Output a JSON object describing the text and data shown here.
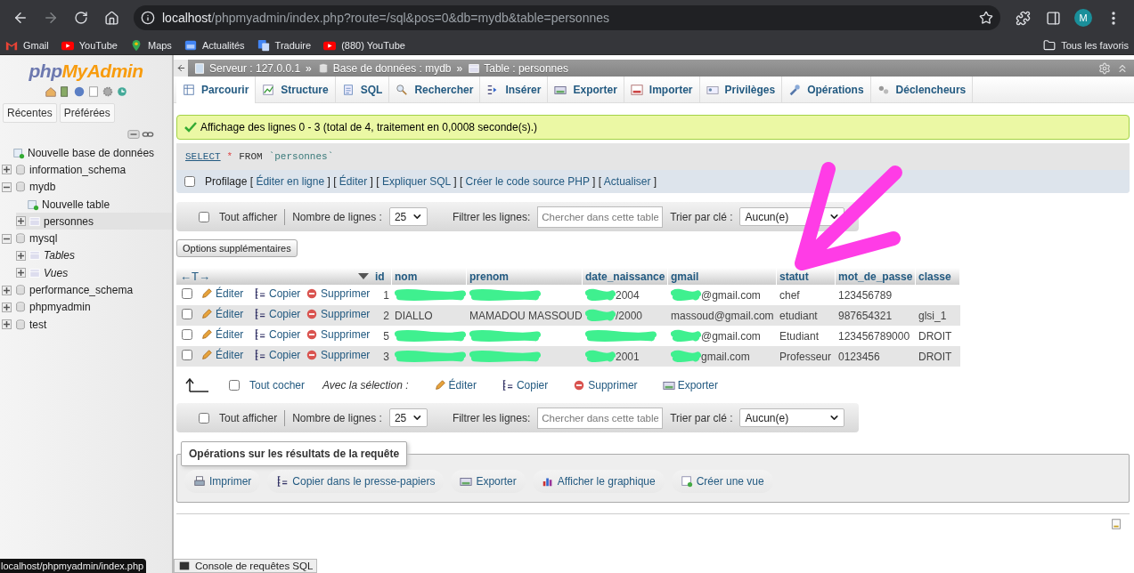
{
  "browser": {
    "url_host": "localhost",
    "url_path": "/phpmyadmin/index.php?route=/sql&pos=0&db=mydb&table=personnes",
    "profile_initial": "M",
    "bookmarks": [
      "Gmail",
      "YouTube",
      "Maps",
      "Actualités",
      "Traduire",
      "(880) YouTube"
    ],
    "all_bookmarks": "Tous les favoris"
  },
  "sidebar": {
    "logo": [
      "php",
      "MyAdmin"
    ],
    "buttons": [
      "Récentes",
      "Préférées"
    ],
    "tree": [
      {
        "label": "Nouvelle base de données",
        "kind": "new",
        "selected": false
      },
      {
        "label": "information_schema",
        "kind": "database",
        "expanded": false,
        "selected": false
      },
      {
        "label": "mydb",
        "kind": "database",
        "expanded": true,
        "selected": false,
        "children": [
          {
            "label": "Nouvelle table",
            "kind": "new",
            "selected": false
          },
          {
            "label": "personnes",
            "kind": "table",
            "expanded": false,
            "selected": true
          }
        ]
      },
      {
        "label": "mysql",
        "kind": "database",
        "expanded": true,
        "selected": false,
        "children": [
          {
            "label": "Tables",
            "kind": "group",
            "expanded": false,
            "selected": false
          },
          {
            "label": "Vues",
            "kind": "group",
            "expanded": false,
            "selected": false
          }
        ]
      },
      {
        "label": "performance_schema",
        "kind": "database",
        "expanded": false,
        "selected": false
      },
      {
        "label": "phpmyadmin",
        "kind": "database",
        "expanded": false,
        "selected": false
      },
      {
        "label": "test",
        "kind": "database",
        "expanded": false,
        "selected": false
      }
    ]
  },
  "breadcrumb": [
    {
      "label": "Serveur : 127.0.0.1",
      "separator": "»"
    },
    {
      "label": "Base de données : mydb",
      "separator": "»"
    },
    {
      "label": "Table : personnes"
    }
  ],
  "tabs": [
    {
      "label": "Parcourir",
      "selected": true
    },
    {
      "label": "Structure",
      "selected": false
    },
    {
      "label": "SQL",
      "selected": false
    },
    {
      "label": "Rechercher",
      "selected": false
    },
    {
      "label": "Insérer",
      "selected": false
    },
    {
      "label": "Exporter",
      "selected": false
    },
    {
      "label": "Importer",
      "selected": false
    },
    {
      "label": "Privilèges",
      "selected": false
    },
    {
      "label": "Opérations",
      "selected": false
    },
    {
      "label": "Déclencheurs",
      "selected": false
    }
  ],
  "message": "Affichage des lignes 0 - 3 (total de 4, traitement en 0,0008 seconde(s).)",
  "query": [
    {
      "kind": "keyword",
      "text": "SELECT"
    },
    {
      "kind": "operator",
      "text": "*"
    },
    {
      "kind": "plain",
      "text": "FROM"
    },
    {
      "kind": "identifier",
      "text": "`personnes`"
    }
  ],
  "profiling": {
    "checked": false,
    "label": "Profilage",
    "links": [
      {
        "open": "[",
        "text": "Éditer en ligne",
        "close": "]"
      },
      {
        "open": "[",
        "text": "Éditer",
        "close": "]"
      },
      {
        "open": "[",
        "text": "Expliquer SQL",
        "close": "]"
      },
      {
        "open": "[",
        "text": "Créer le code source PHP",
        "close": "]"
      },
      {
        "open": "[",
        "text": "Actualiser",
        "close": "]"
      }
    ]
  },
  "nav_top": {
    "show_all": {
      "label": "Tout afficher",
      "checked": false
    },
    "rows_label": "Nombre de lignes :",
    "rows_value": "25",
    "filter_label": "Filtrer les lignes:",
    "filter_placeholder": "Chercher dans cette table",
    "sort_label": "Trier par clé :",
    "sort_value": "Aucun(e)"
  },
  "more_options": "Options supplémentaires",
  "table": {
    "move_label": "←T→",
    "columns": [
      "id",
      "nom",
      "prenom",
      "date_naissance",
      "gmail",
      "statut",
      "mot_de_passe",
      "classe"
    ],
    "rows": [
      {
        "checked": false,
        "actions": [
          "Éditer",
          "Copier",
          "Supprimer"
        ],
        "cells": [
          {
            "text": "1"
          },
          {
            "redacted": true
          },
          {
            "redacted": true
          },
          {
            "text": "2004",
            "redacted": true
          },
          {
            "text": "@gmail.com",
            "redacted": true
          },
          {
            "text": "chef"
          },
          {
            "text": "123456789"
          },
          {}
        ]
      },
      {
        "checked": false,
        "actions": [
          "Éditer",
          "Copier",
          "Supprimer"
        ],
        "cells": [
          {
            "text": "2"
          },
          {
            "text": "DIALLO"
          },
          {
            "text": "MAMADOU MASSOUD"
          },
          {
            "text": "/2000",
            "redacted": true
          },
          {
            "text": "massoud@gmail.com"
          },
          {
            "text": "etudiant"
          },
          {
            "text": "987654321"
          },
          {
            "text": "glsi_1"
          }
        ]
      },
      {
        "checked": false,
        "actions": [
          "Éditer",
          "Copier",
          "Supprimer"
        ],
        "cells": [
          {
            "text": "5"
          },
          {
            "redacted": true
          },
          {
            "redacted": true
          },
          {
            "redacted": true
          },
          {
            "text": "@gmail.com",
            "redacted": true
          },
          {
            "text": "Etudiant"
          },
          {
            "text": "123456789000"
          },
          {
            "text": "DROIT"
          }
        ]
      },
      {
        "checked": false,
        "actions": [
          "Éditer",
          "Copier",
          "Supprimer"
        ],
        "cells": [
          {
            "text": "3"
          },
          {
            "redacted": true
          },
          {
            "redacted": true
          },
          {
            "text": "2001",
            "redacted": true
          },
          {
            "text": "gmail.com",
            "redacted": true
          },
          {
            "text": "Professeur"
          },
          {
            "text": "0123456"
          },
          {
            "text": "DROIT"
          }
        ]
      }
    ]
  },
  "bulk": {
    "check_all": {
      "label": "Tout cocher",
      "checked": false
    },
    "with_selection": "Avec la sélection :",
    "actions": [
      "Éditer",
      "Copier",
      "Supprimer",
      "Exporter"
    ]
  },
  "nav_bottom": {
    "show_all": {
      "label": "Tout afficher",
      "checked": false
    },
    "rows_label": "Nombre de lignes :",
    "rows_value": "25",
    "filter_label": "Filtrer les lignes:",
    "filter_placeholder": "Chercher dans cette table",
    "sort_label": "Trier par clé :",
    "sort_value": "Aucun(e)"
  },
  "query_ops": {
    "title": "Opérations sur les résultats de la requête",
    "buttons": [
      "Imprimer",
      "Copier dans le presse-papiers",
      "Exporter",
      "Afficher le graphique",
      "Créer une vue"
    ]
  },
  "console": "Console de requêtes SQL",
  "status_url": "localhost/phpmyadmin/index.php"
}
